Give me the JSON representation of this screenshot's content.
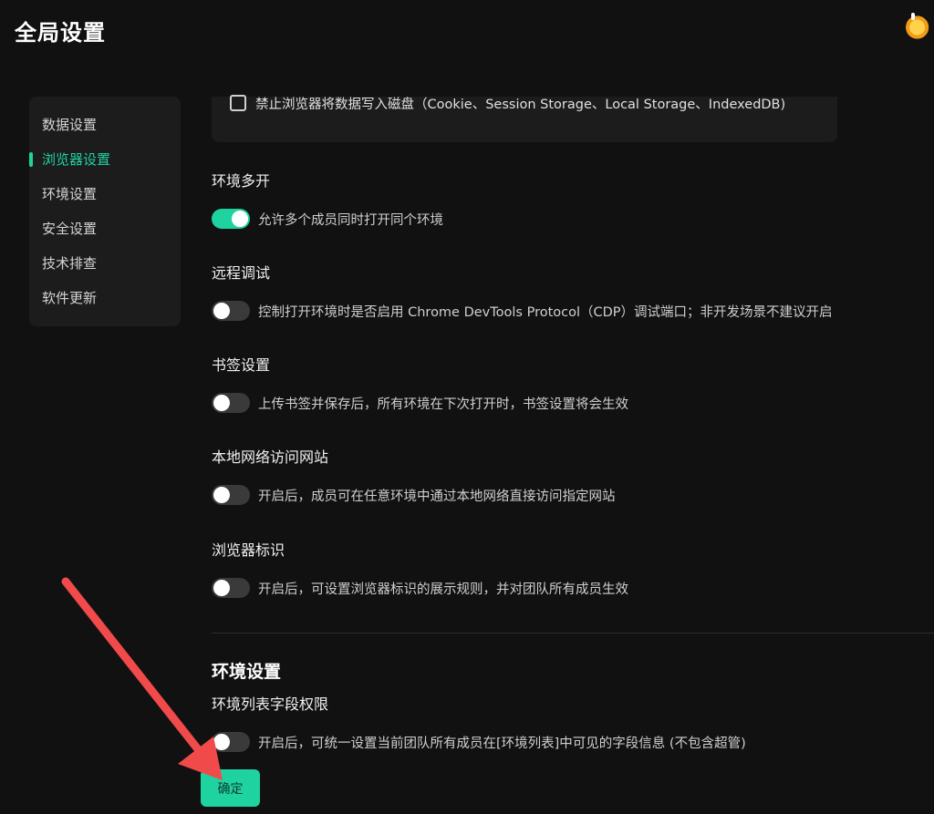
{
  "header": {
    "title": "全局设置"
  },
  "sidebar": {
    "items": [
      {
        "label": "数据设置"
      },
      {
        "label": "浏览器设置"
      },
      {
        "label": "环境设置"
      },
      {
        "label": "安全设置"
      },
      {
        "label": "技术排查"
      },
      {
        "label": "软件更新"
      }
    ],
    "active": "浏览器设置"
  },
  "storage_option": {
    "label": "禁止浏览器将数据写入磁盘（Cookie、Session Storage、Local Storage、IndexedDB)",
    "checked": false
  },
  "settings": [
    {
      "title": "环境多开",
      "description": "允许多个成员同时打开同个环境",
      "enabled": true
    },
    {
      "title": "远程调试",
      "description": "控制打开环境时是否启用 Chrome DevTools Protocol（CDP）调试端口；非开发场景不建议开启",
      "enabled": false
    },
    {
      "title": "书签设置",
      "description": "上传书签并保存后，所有环境在下次打开时，书签设置将会生效",
      "enabled": false
    },
    {
      "title": "本地网络访问网站",
      "description": "开启后，成员可在任意环境中通过本地网络直接访问指定网站",
      "enabled": false
    },
    {
      "title": "浏览器标识",
      "description": "开启后，可设置浏览器标识的展示规则，并对团队所有成员生效",
      "enabled": false
    }
  ],
  "env_section": {
    "title": "环境设置",
    "field_permission": {
      "title": "环境列表字段权限",
      "description": "开启后，可统一设置当前团队所有成员在[环境列表]中可见的字段信息 (不包含超管)",
      "enabled": false
    }
  },
  "footer": {
    "confirm_label": "确定"
  },
  "colors": {
    "accent": "#1fd3a1",
    "background": "#111111",
    "panel": "#1c1c1c",
    "annotation_arrow": "#f04a4a"
  }
}
